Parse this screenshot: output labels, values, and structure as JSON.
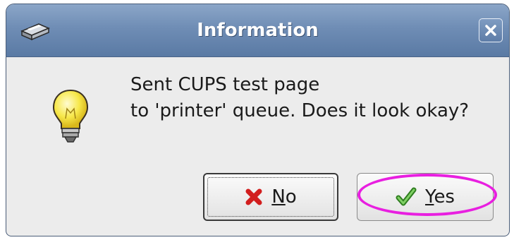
{
  "dialog": {
    "title": "Information",
    "message_line1": "Sent CUPS test page",
    "message_line2": "to 'printer' queue.  Does it look okay?",
    "buttons": {
      "no_label": "No",
      "no_mnemonic": "N",
      "no_rest": "o",
      "yes_label": "Yes",
      "yes_mnemonic": "Y",
      "yes_rest": "es"
    }
  },
  "icons": {
    "app": "printer-icon",
    "close": "close-icon",
    "message": "lightbulb-icon",
    "no": "red-x-icon",
    "yes": "green-checkmark-icon"
  },
  "colors": {
    "titlebar": "#6f8db5",
    "highlight_annotation": "#e81fe0",
    "no_icon": "#d21e1e",
    "yes_icon": "#3c9a2a"
  }
}
